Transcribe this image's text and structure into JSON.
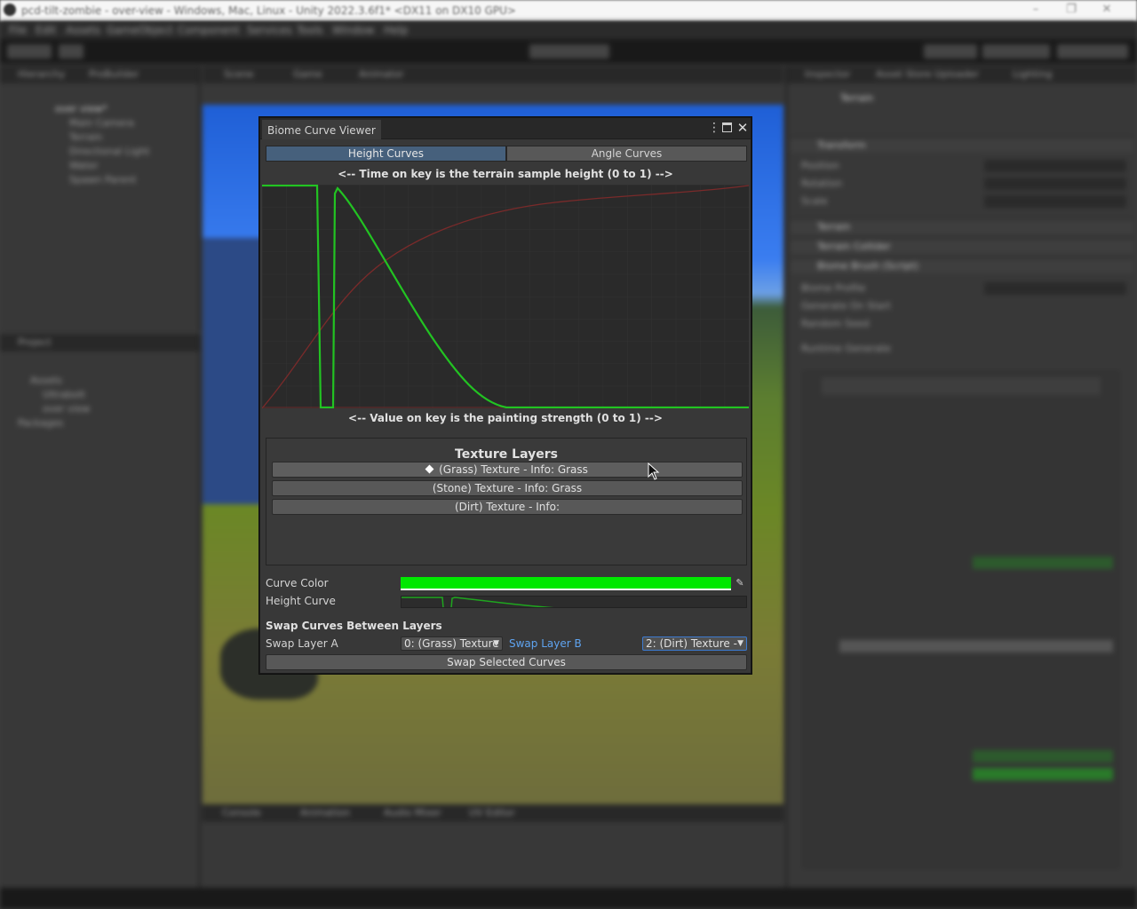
{
  "os_window": {
    "title": "pcd-tilt-zombie - over-view - Windows, Mac, Linux - Unity 2022.3.6f1* <DX11 on DX10 GPU>"
  },
  "unity_menu": [
    "File",
    "Edit",
    "Assets",
    "GameObject",
    "Component",
    "Services",
    "Tools",
    "Window",
    "Help"
  ],
  "hierarchy": {
    "tabs": [
      "Hierarchy",
      "ProBuilder"
    ],
    "items": [
      "over view*",
      "Main Camera",
      "Terrain",
      "Directional Light",
      "Water",
      "Spawn Parent"
    ]
  },
  "project": {
    "tab": "Project",
    "items": [
      "Assets",
      "Ultrabolt",
      "over view",
      "Packages"
    ]
  },
  "scene": {
    "tabs": [
      "Scene",
      "Game",
      "Animator"
    ]
  },
  "console": {
    "tabs": [
      "Console",
      "Animation",
      "Audio Mixer",
      "UV Editor"
    ]
  },
  "inspector": {
    "tabs": [
      "Inspector",
      "Asset Store Uploader",
      "Lighting"
    ],
    "object_name": "Terrain",
    "components": [
      "Transform",
      "Terrain",
      "Terrain Collider",
      "Biome Brush (Script)"
    ],
    "rows": [
      "Position",
      "Rotation",
      "Scale",
      "Biome Profile",
      "Generate On Start",
      "Random Seed",
      "Runtime Generate"
    ]
  },
  "biome_window": {
    "title": "Biome Curve Viewer",
    "tabs": {
      "height": "Height Curves",
      "angle": "Angle Curves"
    },
    "help_top": "<-- Time on key is the terrain sample height (0 to 1) -->",
    "help_bottom": "<-- Value on key is the painting strength (0 to 1) -->",
    "texture_layers": {
      "title": "Texture Layers",
      "items": [
        {
          "label": "(Grass) Texture - Info: Grass",
          "selected": true
        },
        {
          "label": "(Stone) Texture - Info: Grass",
          "selected": false
        },
        {
          "label": "(Dirt) Texture - Info:",
          "selected": false
        }
      ]
    },
    "curve_color_label": "Curve Color",
    "curve_color": "#00e800",
    "height_curve_label": "Height Curve",
    "swap_section": "Swap Curves Between Layers",
    "swap_layer_a_label": "Swap Layer A",
    "swap_layer_a_value": "0: (Grass) Texture",
    "swap_layer_b_label": "Swap Layer B",
    "swap_layer_b_value": "2: (Dirt) Texture -",
    "swap_button": "Swap Selected Curves"
  },
  "colors": {
    "active_tab": "#46607c",
    "curve_green": "#22c322",
    "curve_red": "#7a2a2a",
    "link_blue": "#5fa4f0"
  }
}
